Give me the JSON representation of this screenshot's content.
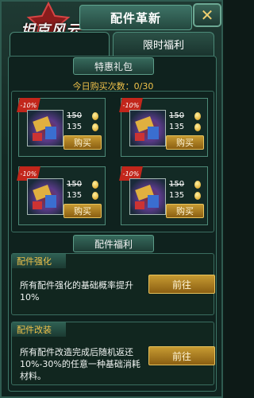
{
  "header": {
    "logo_text": "坦克风云",
    "title": "配件革新",
    "close_icon": "close-icon"
  },
  "tabs": [
    {
      "label": ""
    },
    {
      "label": "限时福利"
    }
  ],
  "special_gift": {
    "section_title": "特惠礼包",
    "today_count": "今日购买次数：0/30",
    "items": [
      {
        "discount": "-10%",
        "old_price": "150",
        "new_price": "135",
        "buy_label": "购买"
      },
      {
        "discount": "-10%",
        "old_price": "150",
        "new_price": "135",
        "buy_label": "购买"
      },
      {
        "discount": "-10%",
        "old_price": "150",
        "new_price": "135",
        "buy_label": "购买"
      },
      {
        "discount": "-10%",
        "old_price": "150",
        "new_price": "135",
        "buy_label": "购买"
      }
    ]
  },
  "benefits": {
    "section_title": "配件福利",
    "items": [
      {
        "tag": "配件强化",
        "text": "所有配件强化的基础概率提升10%",
        "button": "前往"
      },
      {
        "tag": "配件改装",
        "text": "所有配件改造完成后随机返还10%-30%的任意一种基础消耗材料。",
        "button": "前往"
      }
    ]
  },
  "colors": {
    "accent_gold": "#f0c24a",
    "discount_red": "#c2261b",
    "frame_green": "#2f5b50"
  }
}
